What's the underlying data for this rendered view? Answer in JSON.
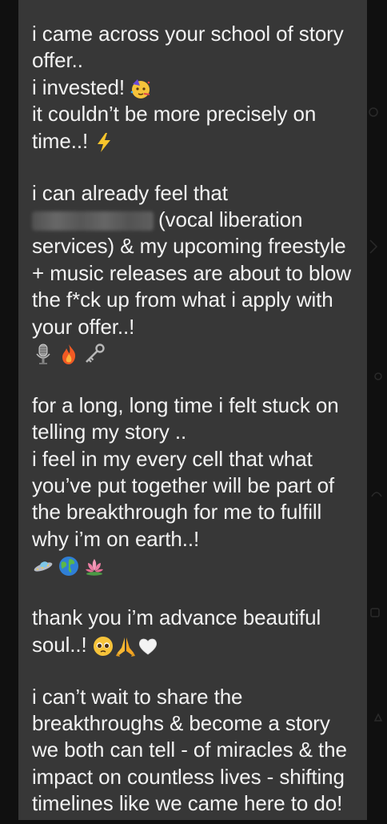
{
  "message": {
    "lines": [
      {
        "text": "i came across your school of story"
      },
      {
        "text": "offer.."
      },
      {
        "text": "i invested!",
        "emoji": "partying-face-icon"
      },
      {
        "text": "it couldn’t be more precisely on"
      },
      {
        "text": "time..!",
        "emoji": "lightning-icon"
      },
      {
        "text": ""
      },
      {
        "text": "i can already feel that"
      },
      {
        "text": "(vocal liberation",
        "redacted": true
      },
      {
        "text": "services) & my upcoming freestyle"
      },
      {
        "text": "+ music releases are about to blow"
      },
      {
        "text": "the f*ck up from what i apply with"
      },
      {
        "text": "your offer..!"
      },
      {
        "emojis": [
          "microphone-icon",
          "fire-icon",
          "old-key-icon"
        ]
      },
      {
        "text": ""
      },
      {
        "text": "for a long, long time i felt stuck on"
      },
      {
        "text": "telling my story .."
      },
      {
        "text": "i feel in my every cell that what"
      },
      {
        "text": "you’ve put together will be part of"
      },
      {
        "text": "the breakthrough for me to fulfill"
      },
      {
        "text": "why i’m on earth..!"
      },
      {
        "emojis": [
          "flying-saucer-icon",
          "globe-icon",
          "lotus-icon"
        ]
      },
      {
        "text": ""
      },
      {
        "text": "thank you i’m advance beautiful"
      },
      {
        "text": "soul..!",
        "emojis_after": [
          "pleading-face-icon",
          "folded-hands-icon",
          "white-heart-icon"
        ]
      },
      {
        "text": ""
      },
      {
        "text": "i can’t wait to share the"
      },
      {
        "text": "breakthroughs & become a story"
      },
      {
        "text": "we both can tell - of miracles & the"
      },
      {
        "text": "impact on countless lives - shifting"
      },
      {
        "text": "timelines like we came here to do!"
      }
    ]
  },
  "colors": {
    "bubble": "#373737",
    "background": "#101010",
    "text": "#f2f2f2"
  }
}
